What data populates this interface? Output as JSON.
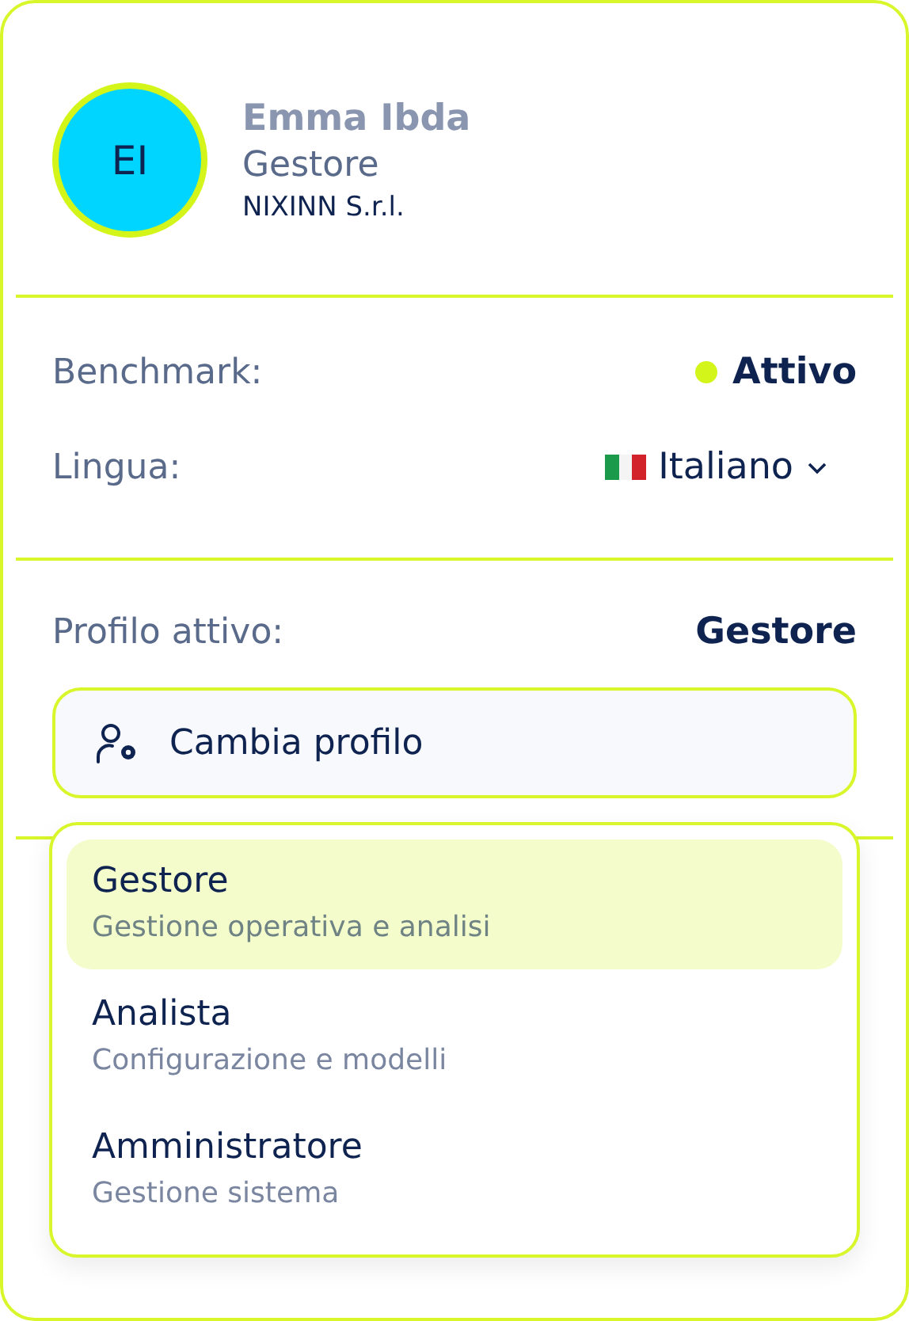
{
  "user": {
    "initials": "EI",
    "name": "Emma Ibda",
    "role": "Gestore",
    "company": "NIXINN S.r.l."
  },
  "settings": [
    {
      "kind": "status",
      "label": "Benchmark:",
      "value": "Attivo",
      "color": "#d4f51a"
    },
    {
      "kind": "language",
      "label": "Lingua:",
      "value": "Italiano"
    }
  ],
  "profile": {
    "label": "Profilo attivo:",
    "value": "Gestore",
    "button": "Cambia profilo"
  },
  "profile_menu": [
    {
      "title": "Gestore",
      "description": "Gestione operativa e analisi",
      "selected": true
    },
    {
      "title": "Analista",
      "description": "Configurazione e modelli",
      "selected": false
    },
    {
      "title": "Amministratore",
      "description": "Gestione sistema",
      "selected": false
    }
  ]
}
